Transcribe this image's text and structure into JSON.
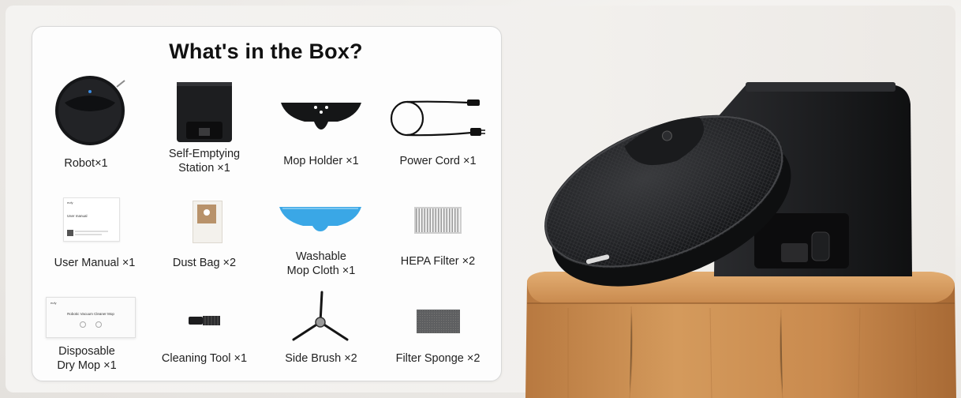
{
  "title": "What's in the Box?",
  "items": [
    {
      "label": "Robot×1",
      "icon": "robot-vacuum-icon"
    },
    {
      "label": "Self-Emptying\nStation ×1",
      "icon": "station-icon"
    },
    {
      "label": "Mop Holder ×1",
      "icon": "mop-holder-icon"
    },
    {
      "label": "Power Cord ×1",
      "icon": "power-cord-icon"
    },
    {
      "label": "User Manual ×1",
      "icon": "user-manual-icon"
    },
    {
      "label": "Dust Bag ×2",
      "icon": "dust-bag-icon"
    },
    {
      "label": "Washable\nMop Cloth ×1",
      "icon": "mop-cloth-icon"
    },
    {
      "label": "HEPA Filter ×2",
      "icon": "hepa-filter-icon"
    },
    {
      "label": "Disposable\nDry Mop ×1",
      "icon": "dry-mop-icon"
    },
    {
      "label": "Cleaning Tool ×1",
      "icon": "cleaning-tool-icon"
    },
    {
      "label": "Side Brush ×2",
      "icon": "side-brush-icon"
    },
    {
      "label": "Filter Sponge ×2",
      "icon": "filter-sponge-icon"
    }
  ],
  "manual_text": {
    "brand": "eufy",
    "heading": "User manual"
  },
  "dry_mop_text": {
    "brand": "eufy",
    "heading": "Robotic Vacuum Cleaner Mop"
  },
  "colors": {
    "card_bg": "#fdfdfd",
    "mop_blue": "#3aa7e6",
    "robot_black": "#1b1c1e",
    "wood": "#c98a4e"
  }
}
